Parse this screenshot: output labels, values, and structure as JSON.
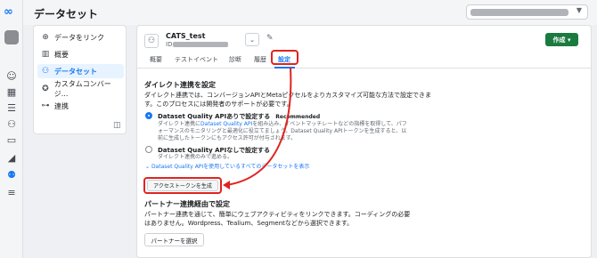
{
  "header": {
    "title": "データセット"
  },
  "nav": {
    "items": [
      {
        "icon": "plus-circle-icon",
        "label": "データをリンク"
      },
      {
        "icon": "grid-icon",
        "label": "概要"
      },
      {
        "icon": "people-icon",
        "label": "データセット"
      },
      {
        "icon": "star-icon",
        "label": "カスタムコンバージ..."
      },
      {
        "icon": "link-icon",
        "label": "連携"
      }
    ]
  },
  "dataset": {
    "name": "CATS_test",
    "id_label": "ID",
    "create_label": "作成 ▾"
  },
  "tabs": [
    "概要",
    "テストイベント",
    "診断",
    "履歴",
    "設定"
  ],
  "selected_tab": "設定",
  "direct": {
    "title": "ダイレクト連携を設定",
    "desc": "ダイレクト連携では、コンバージョンAPIとMetaピクセルをよりカスタマイズ可能な方法で設定できます。このプロセスには開発者のサポートが必要です。",
    "option1_title": "Dataset Quality APIありで設定する",
    "option1_badge": "Recommended",
    "option1_desc_a": "ダイレクト連携に",
    "option1_desc_link": "Dataset Quality API",
    "option1_desc_b": "を組み込み、イベントマッチレートなどの指標を取得して、パフォーマンスのモニタリングと最適化に役立てましょう。Dataset Quality APIトークンを生成すると、以前に生成したトークンにもアクセス許可が付与されます。",
    "option2_title": "Dataset Quality APIなしで設定する",
    "option2_desc": "ダイレクト連携のみで進める。",
    "expand_link": "Dataset Quality APIを使用しているすべてのデータセットを表示",
    "token_button": "アクセストークンを生成"
  },
  "partner": {
    "title": "パートナー連携経由で設定",
    "desc": "パートナー連携を通じて、簡単にウェブアクティビティをリンクできます。コーディングの必要はありません。Wordpress、Tealium、Segmentなどから選択できます。",
    "button": "パートナーを選択"
  },
  "colors": {
    "accent": "#1877f2",
    "create_button": "#1b7a3f",
    "highlight": "#e0231f"
  }
}
